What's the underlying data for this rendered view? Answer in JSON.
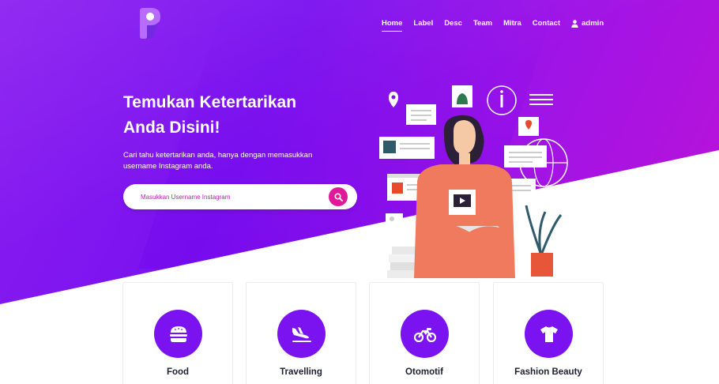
{
  "nav": {
    "items": [
      {
        "label": "Home",
        "active": true
      },
      {
        "label": "Label",
        "active": false
      },
      {
        "label": "Desc",
        "active": false
      },
      {
        "label": "Team",
        "active": false
      },
      {
        "label": "Mitra",
        "active": false
      },
      {
        "label": "Contact",
        "active": false
      }
    ],
    "user_label": "admin",
    "user_icon": "user-icon"
  },
  "hero": {
    "title_line1": "Temukan Ketertarikan",
    "title_line2": "Anda Disini!",
    "subtitle_line1": "Cari tahu ketertarikan anda, hanya dengan memasukkan",
    "subtitle_line2": "username Instagram anda.",
    "search_placeholder": "Masukkan Username Instagram",
    "search_icon": "search-icon"
  },
  "categories": [
    {
      "label": "Food",
      "icon": "burger-icon"
    },
    {
      "label": "Travelling",
      "icon": "plane-landing-icon"
    },
    {
      "label": "Otomotif",
      "icon": "motorcycle-icon"
    },
    {
      "label": "Fashion Beauty",
      "icon": "tshirt-icon"
    }
  ],
  "colors": {
    "primary": "#7b12f0",
    "accent": "#e0199b",
    "hero_gradient_end": "#c012d6"
  }
}
